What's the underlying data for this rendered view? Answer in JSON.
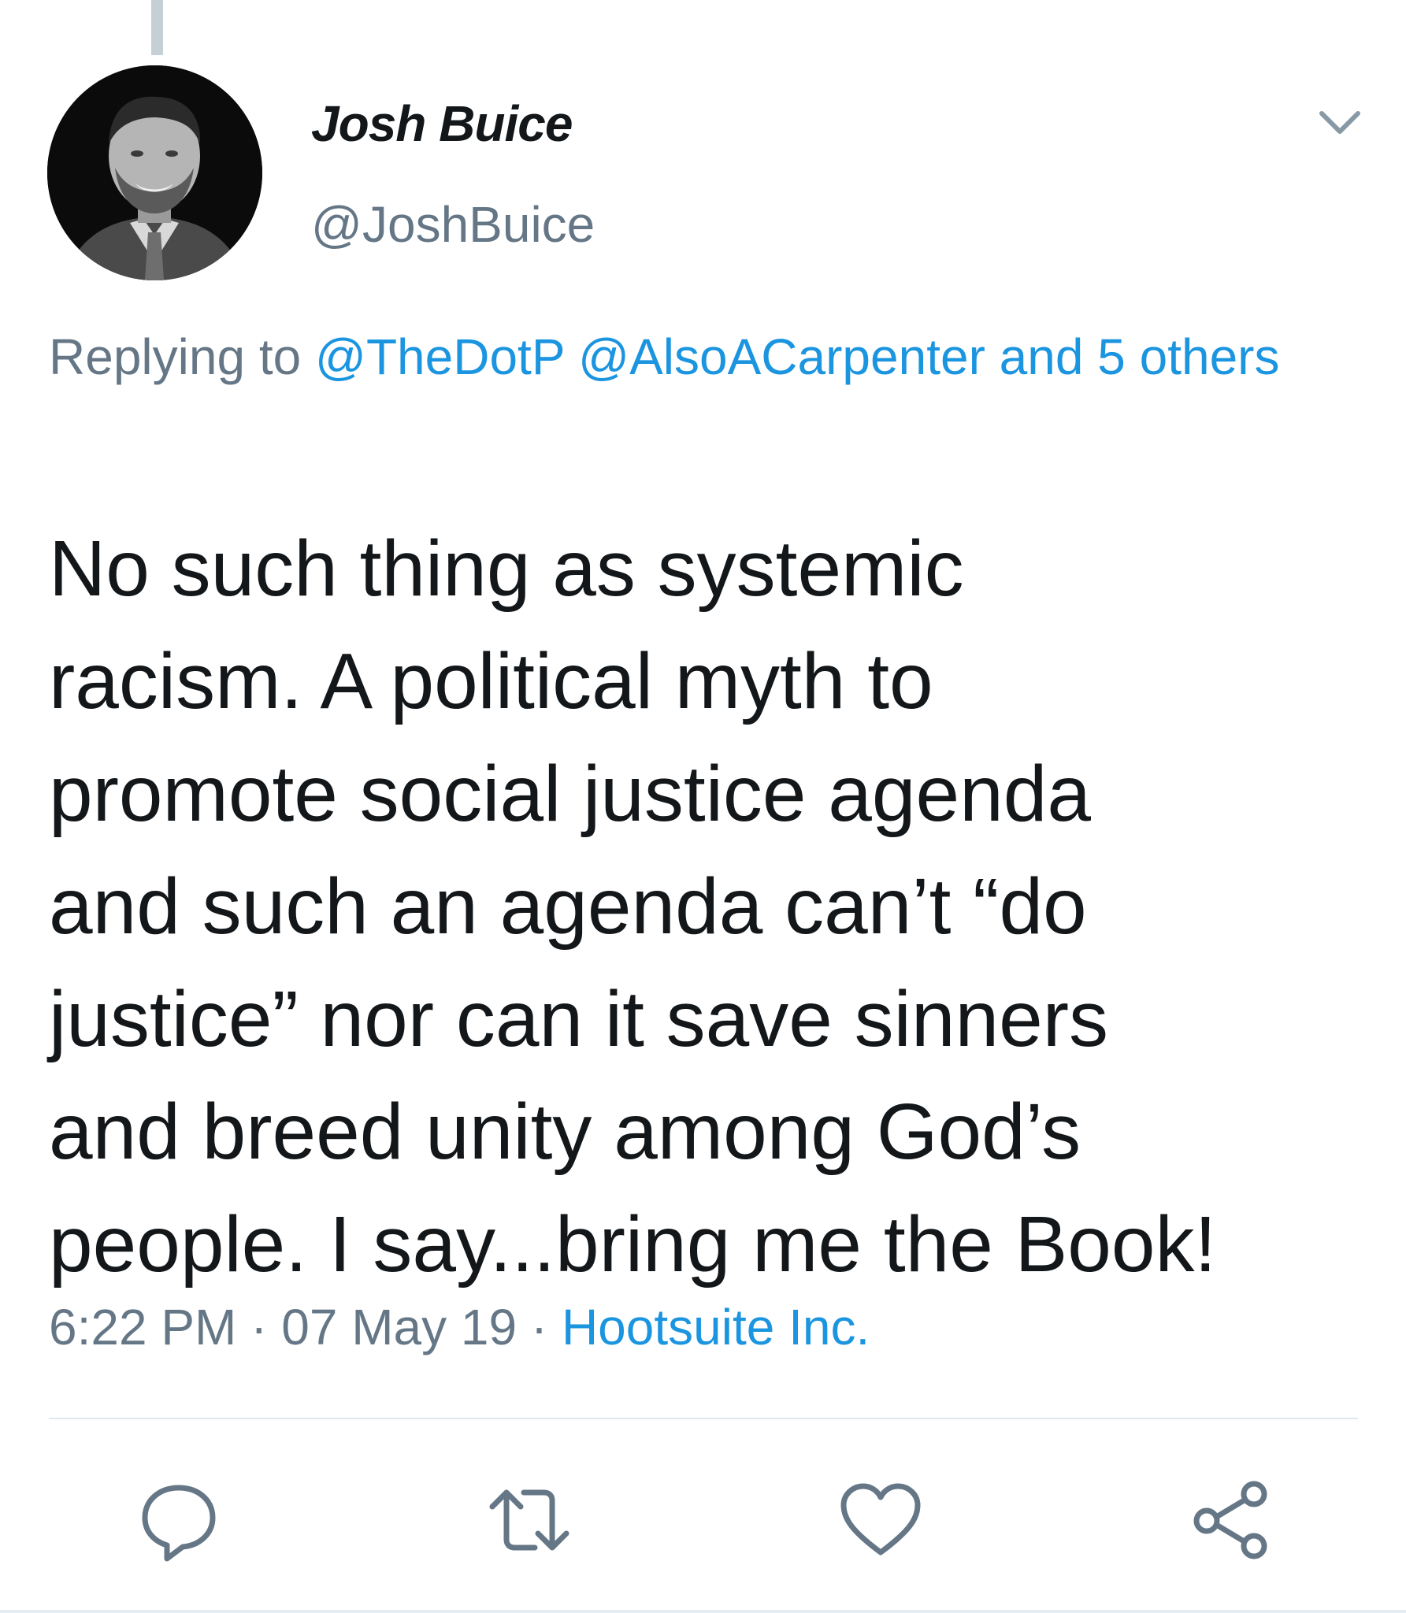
{
  "tweet": {
    "author": {
      "display_name": "Josh Buice",
      "handle": "@JoshBuice",
      "avatar": "profile-photo"
    },
    "reply_context": {
      "prefix": "Replying to",
      "mentions": [
        "@TheDotP",
        "@AlsoACarpenter"
      ],
      "others": "and 5 others"
    },
    "text_lines": [
      "No such thing as systemic",
      "racism. A political myth to",
      "promote social justice agenda",
      "and such an agenda can’t “do",
      "justice” nor can it save sinners",
      "and breed unity among God’s",
      "people. I say...bring me the Book!"
    ],
    "time": "6:22 PM",
    "date": "07 May 19",
    "separator": "·",
    "source": "Hootsuite Inc."
  },
  "actions": [
    {
      "name": "reply",
      "icon": "speech-bubble-icon"
    },
    {
      "name": "retweet",
      "icon": "retweet-icon"
    },
    {
      "name": "like",
      "icon": "heart-icon"
    },
    {
      "name": "share",
      "icon": "share-icon"
    }
  ],
  "colors": {
    "text": "#14171a",
    "secondary": "#657786",
    "link": "#1b95e0",
    "divider": "#e1e8ed"
  }
}
